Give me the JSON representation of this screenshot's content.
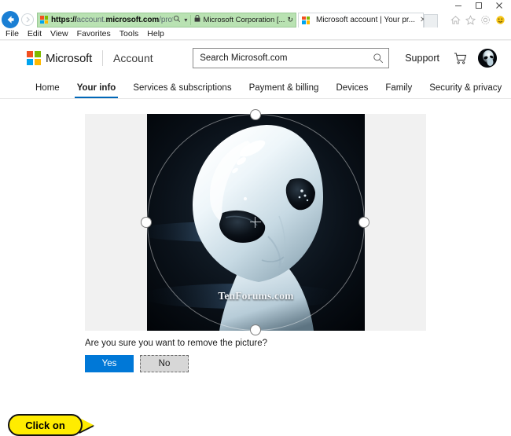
{
  "window": {
    "minimize_label": "–",
    "maximize_label": "□",
    "close_label": "✕"
  },
  "browser": {
    "back_label": "←",
    "forward_label": "→",
    "address": {
      "scheme": "https://",
      "host_dim": "account.",
      "host_bold": "microsoft.com",
      "path": "/profile#/edit-picture",
      "full_url": "https://account.microsoft.com/profile#/edit-picture",
      "search_hint": "⌕",
      "dropdown": "▾",
      "lock_icon": "lock-icon",
      "certificate": "Microsoft Corporation [...",
      "refresh": "↻"
    },
    "tabs": [
      {
        "title": "Microsoft account | Your pr...",
        "close": "✕",
        "favicon": "microsoft-favicon"
      }
    ],
    "new_tab_label": "",
    "toolbar_icons": [
      "home-icon",
      "favorites-star-icon",
      "settings-gear-icon",
      "smiley-feedback-icon"
    ],
    "menu": [
      "File",
      "Edit",
      "View",
      "Favorites",
      "Tools",
      "Help"
    ]
  },
  "site_header": {
    "brand": "Microsoft",
    "product": "Account",
    "search": {
      "placeholder": "Search Microsoft.com",
      "value": "",
      "icon": "search-icon"
    },
    "support_label": "Support",
    "cart_icon": "shopping-cart-icon",
    "avatar_label": "avatar"
  },
  "nav": {
    "items": [
      {
        "label": "Home",
        "active": false
      },
      {
        "label": "Your info",
        "active": true
      },
      {
        "label": "Services & subscriptions",
        "active": false
      },
      {
        "label": "Payment & billing",
        "active": false
      },
      {
        "label": "Devices",
        "active": false
      },
      {
        "label": "Family",
        "active": false
      },
      {
        "label": "Security & privacy",
        "active": false
      }
    ]
  },
  "editor": {
    "watermark": "TenForums.com",
    "handles": [
      "crop-handle-top",
      "crop-handle-right",
      "crop-handle-bottom",
      "crop-handle-left"
    ],
    "center_marker": "crop-center-crosshair"
  },
  "confirm": {
    "question": "Are you sure you want to remove the picture?",
    "yes_label": "Yes",
    "no_label": "No"
  },
  "annotation": {
    "callout_text": "Click on"
  },
  "colors": {
    "accent_blue": "#0078d7",
    "tab_underline": "#0067b8",
    "address_green": "#b9e2b2",
    "callout_yellow": "#ffec00",
    "stage_gray": "#f1f1f1"
  }
}
